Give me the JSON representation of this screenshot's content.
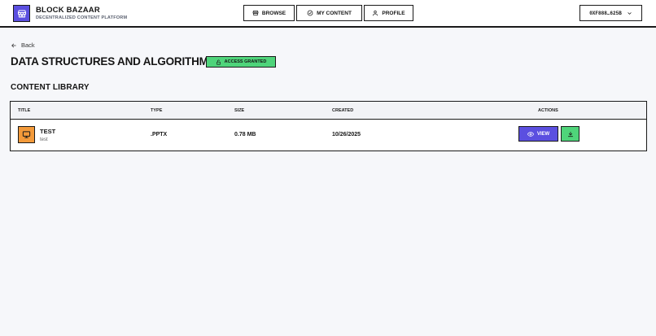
{
  "header": {
    "brand_title": "BLOCK BAZAAR",
    "brand_subtitle": "DECENTRALIZED CONTENT PLATFORM",
    "nav": [
      {
        "label": "BROWSE",
        "icon": "store-icon"
      },
      {
        "label": "MY CONTENT",
        "icon": "check-circle-icon"
      },
      {
        "label": "PROFILE",
        "icon": "user-icon"
      }
    ],
    "wallet": "0XF888…625B"
  },
  "back_label": "Back",
  "page_title": "DATA STRUCTURES AND ALGORITHMS",
  "access_badge": "ACCESS GRANTED",
  "section_title": "CONTENT LIBRARY",
  "table": {
    "columns": [
      "TITLE",
      "TYPE",
      "SIZE",
      "CREATED",
      "ACTIONS"
    ],
    "rows": [
      {
        "title": "TEST",
        "description": "test",
        "type": ".PPTX",
        "size": "0.78 MB",
        "created": "10/26/2025",
        "view_label": "VIEW"
      }
    ]
  },
  "colors": {
    "accent": "#5b4fe0",
    "success": "#4fd47a",
    "file_icon": "#f39a3a",
    "border": "#1a1a1a",
    "background": "#f6f7fa"
  }
}
